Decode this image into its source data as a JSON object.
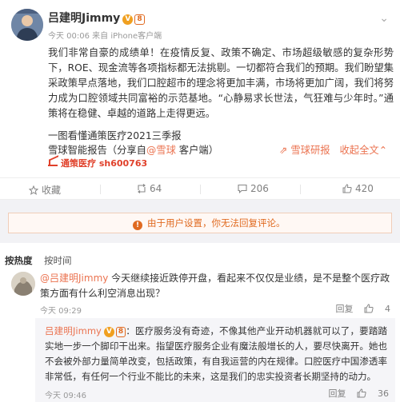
{
  "post": {
    "username": "吕建明Jimmy",
    "verified_badge": "V",
    "level_badge": "8",
    "meta": "今天 00:06 来自 iPhone客户端",
    "text_intro": "我们非常自豪的成绩单！在疫情反复、政策不确定、市场超级敏感的复杂形势下，ROE、现金流等各项指标都无法挑剔。一切都符合我们的预期。我们盼望集采政策早点落地，我们口腔超市的理念将更加丰满，市场将更加广阔，我们将努力成为口腔领域共同富裕的示范基地。",
    "text_quote": "“心静易求长世法，气狂难与少年时。”",
    "text_outro": "通策将在稳健、卓越的道路上走得更远。",
    "line2": "一图看懂通策医疗2021三季报",
    "share_prefix": "雪球智能报告（分享自",
    "share_app": "@雪球",
    "share_suffix": " 客户端）",
    "research_link": "雪球研报",
    "expand_link": "收起全文",
    "stock": "通策医疗 sh600763"
  },
  "actions": {
    "favorite": "收藏",
    "repost": "64",
    "comment": "206",
    "like": "420"
  },
  "restriction_notice": "由于用户设置，你无法回复评论。",
  "sort_tabs": {
    "hot": "按热度",
    "time": "按时间"
  },
  "comment": {
    "mention": "@吕建明Jimmy",
    "text": " 今天继续接近跌停开盘，看起来不仅仅是业绩，是不是整个医疗政策方面有什么利空消息出现？",
    "time": "今天 09:29",
    "reply_label": "回复",
    "likes": "4"
  },
  "reply": {
    "name": "吕建明Jimmy",
    "verified_badge": "V",
    "level_badge": "8",
    "text": "：医疗服务没有奇迹，不像其他产业开动机器就可以了，要踏踏实地一步一个脚印干出来。指望医疗服务企业有魔法般增长的人，要尽快离开。她也不会被外部力量简单改变，包括政策，有自我运营的内在规律。口腔医疗中国渗透率非常低，有任何一个行业不能比的未来，这是我们的忠实投资者长期坚持的动力。",
    "time": "今天 09:46",
    "reply_label": "回复",
    "likes": "36"
  }
}
